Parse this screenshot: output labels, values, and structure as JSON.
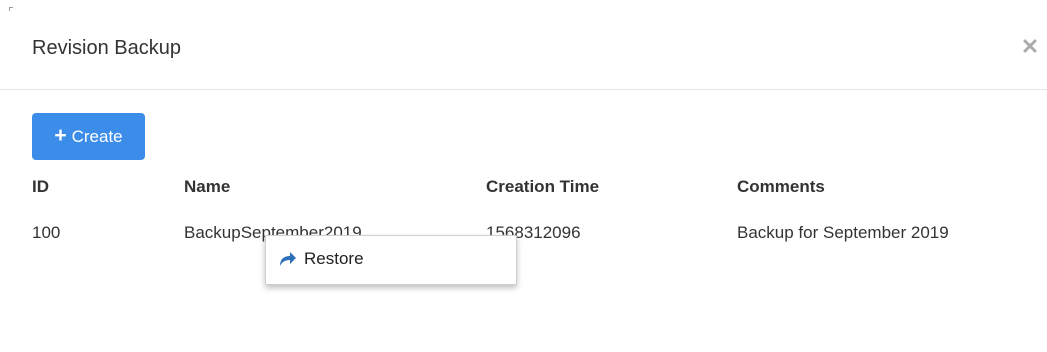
{
  "dialog": {
    "title": "Revision Backup",
    "close_icon": "close-icon"
  },
  "toolbar": {
    "create_label": "Create",
    "create_icon": "plus-icon",
    "accent_color": "#3c8dea"
  },
  "table": {
    "columns": [
      "ID",
      "Name",
      "Creation Time",
      "Comments"
    ],
    "rows": [
      {
        "id": "100",
        "name": "BackupSeptember2019",
        "creation_time": "1568312096",
        "comments": "Backup for September 2019"
      }
    ]
  },
  "context_menu": {
    "items": [
      {
        "label": "Restore",
        "icon": "restore-icon"
      }
    ]
  }
}
